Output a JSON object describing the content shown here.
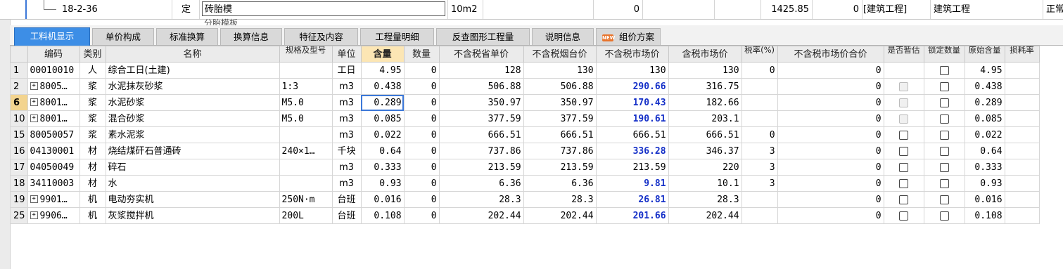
{
  "top_row": {
    "code": "18-2-36",
    "type": "定",
    "name": "砖胎模",
    "unit": "10m2",
    "qty": "0",
    "total": "1425.85",
    "count": "0",
    "category": "[建筑工程]",
    "discipline": "建筑工程",
    "status": "正常",
    "next_row_peek": "分胎模板"
  },
  "tabs": [
    {
      "label": "工料机显示",
      "active": true
    },
    {
      "label": "单价构成"
    },
    {
      "label": "标准换算"
    },
    {
      "label": "换算信息"
    },
    {
      "label": "特征及内容"
    },
    {
      "label": "工程量明细"
    },
    {
      "label": "反查图形工程量"
    },
    {
      "label": "说明信息"
    },
    {
      "label": "组价方案",
      "badge": "NEW"
    }
  ],
  "columns": [
    {
      "label": ""
    },
    {
      "label": "编码"
    },
    {
      "label": "类别"
    },
    {
      "label": "名称"
    },
    {
      "label": "规格及型号"
    },
    {
      "label": "单位"
    },
    {
      "label": "含量"
    },
    {
      "label": "数量"
    },
    {
      "label": "不含税省单价"
    },
    {
      "label": "不含税烟台价"
    },
    {
      "label": "不含税市场价"
    },
    {
      "label": "含税市场价"
    },
    {
      "label": "税率(%)"
    },
    {
      "label": "不含税市场价合价"
    },
    {
      "label": "是否暂估"
    },
    {
      "label": "锁定数量"
    },
    {
      "label": "原始含量"
    },
    {
      "label": "损耗率"
    }
  ],
  "rows": [
    {
      "no": "1",
      "code": "00010010",
      "expand": false,
      "cat": "人",
      "name": "综合工日(土建)",
      "spec": "",
      "unit": "工日",
      "content": "4.95",
      "qty": "0",
      "prov": "128",
      "local": "130",
      "market": "130",
      "market_blue": false,
      "tax_market": "130",
      "tax_rate": "0",
      "total": "0",
      "est": "none",
      "lock": "on",
      "orig": "4.95"
    },
    {
      "no": "2",
      "code": "8005…",
      "expand": true,
      "cat": "浆",
      "name": "水泥抹灰砂浆",
      "spec": "1:3",
      "unit": "m3",
      "content": "0.438",
      "qty": "0",
      "prov": "506.88",
      "local": "506.88",
      "market": "290.66",
      "market_blue": true,
      "tax_market": "316.75",
      "tax_rate": "",
      "total": "0",
      "est": "dis",
      "lock": "on",
      "orig": "0.438"
    },
    {
      "no": "6",
      "code": "8001…",
      "expand": true,
      "cat": "浆",
      "name": "水泥砂浆",
      "spec": "M5.0",
      "unit": "m3",
      "content": "0.289",
      "qty": "0",
      "prov": "350.97",
      "local": "350.97",
      "market": "170.43",
      "market_blue": true,
      "tax_market": "182.66",
      "tax_rate": "",
      "total": "0",
      "est": "dis",
      "lock": "on",
      "orig": "0.289",
      "current": true
    },
    {
      "no": "10",
      "code": "8001…",
      "expand": true,
      "cat": "浆",
      "name": "混合砂浆",
      "spec": "M5.0",
      "unit": "m3",
      "content": "0.085",
      "qty": "0",
      "prov": "377.59",
      "local": "377.59",
      "market": "190.61",
      "market_blue": true,
      "tax_market": "203.1",
      "tax_rate": "",
      "total": "0",
      "est": "dis",
      "lock": "on",
      "orig": "0.085"
    },
    {
      "no": "15",
      "code": "80050057",
      "expand": false,
      "cat": "浆",
      "name": "素水泥浆",
      "spec": "",
      "unit": "m3",
      "content": "0.022",
      "qty": "0",
      "prov": "666.51",
      "local": "666.51",
      "market": "666.51",
      "market_blue": false,
      "tax_market": "666.51",
      "tax_rate": "0",
      "total": "0",
      "est": "on",
      "lock": "on",
      "orig": "0.022"
    },
    {
      "no": "16",
      "code": "04130001",
      "expand": false,
      "cat": "材",
      "name": "烧结煤矸石普通砖",
      "spec": "240×1…",
      "unit": "千块",
      "content": "0.64",
      "qty": "0",
      "prov": "737.86",
      "local": "737.86",
      "market": "336.28",
      "market_blue": true,
      "tax_market": "346.37",
      "tax_rate": "3",
      "total": "0",
      "est": "on",
      "lock": "on",
      "orig": "0.64"
    },
    {
      "no": "17",
      "code": "04050049",
      "expand": false,
      "cat": "材",
      "name": "碎石",
      "spec": "",
      "unit": "m3",
      "content": "0.333",
      "qty": "0",
      "prov": "213.59",
      "local": "213.59",
      "market": "213.59",
      "market_blue": false,
      "tax_market": "220",
      "tax_rate": "3",
      "total": "0",
      "est": "on",
      "lock": "on",
      "orig": "0.333"
    },
    {
      "no": "18",
      "code": "34110003",
      "expand": false,
      "cat": "材",
      "name": "水",
      "spec": "",
      "unit": "m3",
      "content": "0.93",
      "qty": "0",
      "prov": "6.36",
      "local": "6.36",
      "market": "9.81",
      "market_blue": true,
      "tax_market": "10.1",
      "tax_rate": "3",
      "total": "0",
      "est": "on",
      "lock": "on",
      "orig": "0.93"
    },
    {
      "no": "19",
      "code": "9901…",
      "expand": true,
      "cat": "机",
      "name": "电动夯实机",
      "spec": "250N·m",
      "unit": "台班",
      "content": "0.016",
      "qty": "0",
      "prov": "28.3",
      "local": "28.3",
      "market": "26.81",
      "market_blue": true,
      "tax_market": "28.3",
      "tax_rate": "",
      "total": "0",
      "est": "on",
      "lock": "on",
      "orig": "0.016"
    },
    {
      "no": "25",
      "code": "9906…",
      "expand": true,
      "cat": "机",
      "name": "灰浆搅拌机",
      "spec": "200L",
      "unit": "台班",
      "content": "0.108",
      "qty": "0",
      "prov": "202.44",
      "local": "202.44",
      "market": "201.66",
      "market_blue": true,
      "tax_market": "202.44",
      "tax_rate": "",
      "total": "0",
      "est": "on",
      "lock": "on",
      "orig": "0.108"
    }
  ],
  "colors": {
    "accent": "#3d8ee6",
    "market_blue": "#1530c8",
    "current_row": "#f3d48f",
    "qty_header": "#fce6b4"
  }
}
